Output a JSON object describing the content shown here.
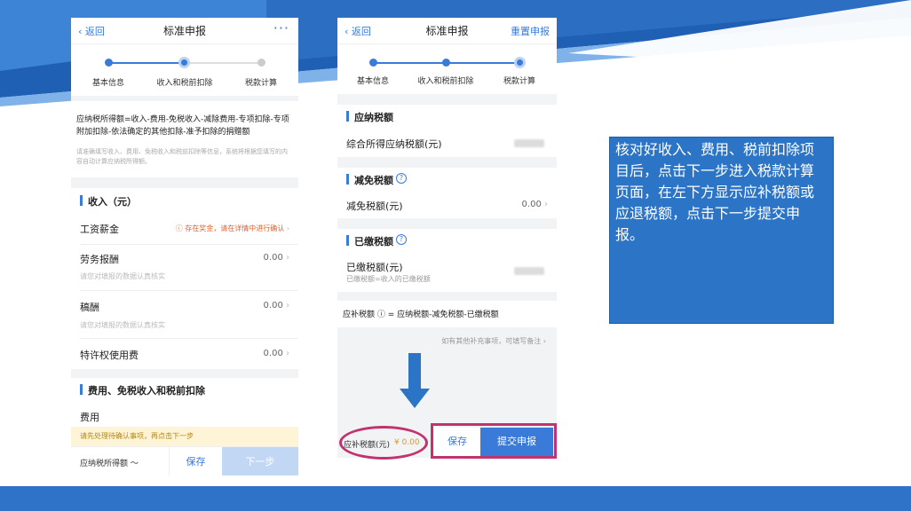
{
  "left_phone": {
    "nav": {
      "back": "返回",
      "title": "标准申报",
      "more": "···"
    },
    "steps": [
      "基本信息",
      "收入和税前扣除",
      "税款计算"
    ],
    "formula": "应纳税所得额=收入-费用-免税收入-减除费用-专项扣除-专项附加扣除-依法确定的其他扣除-准予扣除的捐赠额",
    "formula_note": "请准确填写收入、费用、免税收入和税前扣除等信息，系统将根据您填写的内容自动计算应纳税所得额。",
    "income_section": "收入（元）",
    "rows": [
      {
        "label": "工资薪金",
        "warning": "存在奖金，请在详情中进行确认",
        "chevron": "›"
      },
      {
        "label": "劳务报酬",
        "value": "0.00",
        "chevron": "›",
        "sub": "请您对填报的数据认真核实"
      },
      {
        "label": "稿酬",
        "value": "0.00",
        "chevron": "›",
        "sub": "请您对填报的数据认真核实"
      },
      {
        "label": "特许权使用费",
        "value": "0.00",
        "chevron": "›"
      }
    ],
    "deduction_section": "费用、免税收入和税前扣除",
    "fee_label": "费用",
    "yellow_notice": "请先处理待确认事项，再点击下一步",
    "bottom": {
      "label": "应纳税所得额 ～",
      "save": "保存",
      "next": "下一步"
    }
  },
  "right_phone": {
    "nav": {
      "back": "返回",
      "title": "标准申报",
      "reset": "重置申报"
    },
    "steps": [
      "基本信息",
      "收入和税前扣除",
      "税款计算"
    ],
    "sections": {
      "payable": "应纳税额",
      "payable_row": "综合所得应纳税额(元)",
      "reduction": "减免税额",
      "reduction_row": "减免税额(元)",
      "reduction_value": "0.00",
      "paid": "已缴税额",
      "paid_row": "已缴税额(元)",
      "paid_sub": "已缴税额=收入的已缴税额"
    },
    "supplement_formula": "应补税额 ⓘ = 应纳税额-减免税额-已缴税额",
    "remark": "如有其他补充事项，可填写备注",
    "bottom": {
      "label": "应补税额(元)",
      "value": "¥ 0.00",
      "save": "保存",
      "submit": "提交申报"
    }
  },
  "note": "核对好收入、费用、税前扣除项目后，点击下一步进入税款计算页面，在左下方显示应补税额或应退税额，点击下一步提交申报。",
  "icons": {
    "info": "ⓘ",
    "question": "?",
    "warning": "!"
  },
  "colors": {
    "accent": "#3a7ad8",
    "highlight": "#c0336e",
    "note_bg": "#2b74c6",
    "warning": "#e0612c"
  }
}
